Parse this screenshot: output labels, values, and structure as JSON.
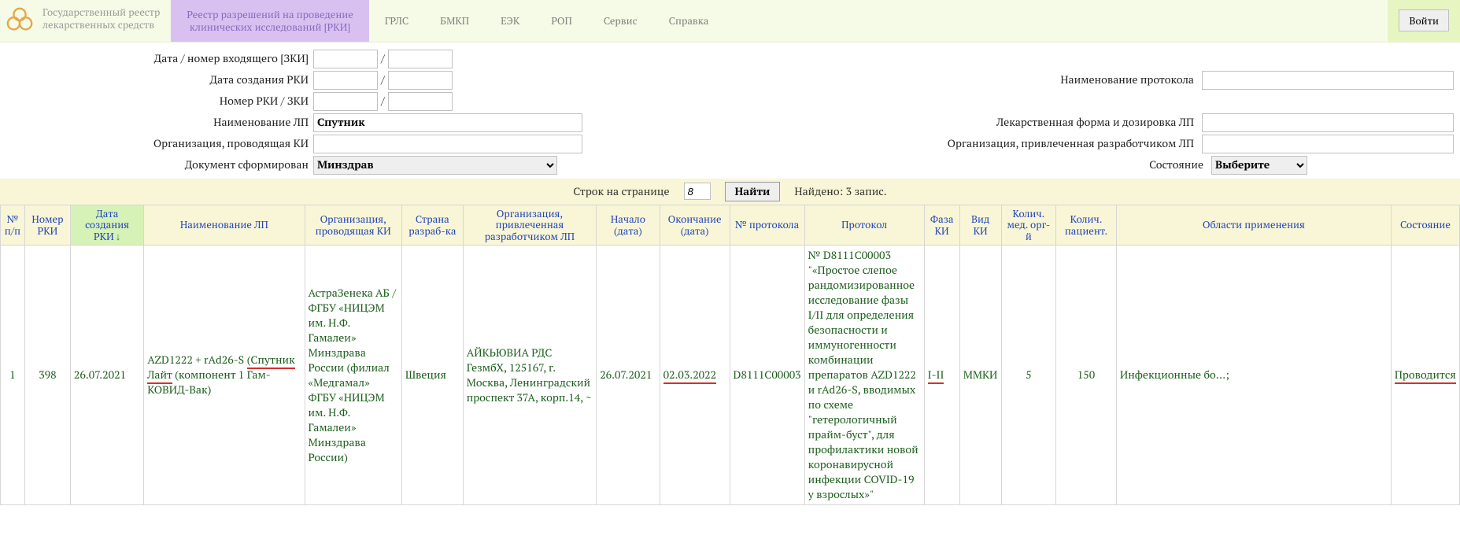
{
  "header": {
    "site_title_l1": "Государственный реестр",
    "site_title_l2": "лекарственных средств",
    "tabs": [
      {
        "label_l1": "Реестр разрешений на проведение",
        "label_l2": "клинических исследований [РКИ]",
        "active": true
      },
      {
        "label": "ГРЛС"
      },
      {
        "label": "БМКП"
      },
      {
        "label": "ЕЭК"
      },
      {
        "label": "РОП"
      },
      {
        "label": "Сервис"
      },
      {
        "label": "Справка"
      }
    ],
    "login_btn": "Войти"
  },
  "filters": {
    "f_dn_in": "Дата / номер входящего [ЗКИ]",
    "f_date_rki": "Дата создания РКИ",
    "f_num_rki": "Номер РКИ / ЗКИ",
    "f_lp_name": "Наименование ЛП",
    "v_lp_name": "Спутник",
    "f_org_conduct": "Организация, проводящая КИ",
    "f_doc_source": "Документ сформирован",
    "v_doc_source": "Минздрав",
    "f_proto_name": "Наименование протокола",
    "f_form_dose": "Лекарственная форма и дозировка ЛП",
    "f_org_dev": "Организация, привлеченная разработчиком ЛП",
    "f_state": "Состояние",
    "v_state": "Выберите"
  },
  "opts": {
    "rows_label": "Строк на странице",
    "rows_value": "8",
    "find_btn": "Найти",
    "found_text": "Найдено: 3 запис."
  },
  "columns": [
    "№ п/п",
    "Номер РКИ",
    "Дата создания РКИ",
    "Наименование ЛП",
    "Организация, проводящая КИ",
    "Страна разраб-ка",
    "Организация, привлеченная разработчиком ЛП",
    "Начало (дата)",
    "Окончание (дата)",
    "№ протокола",
    "Протокол",
    "Фаза КИ",
    "Вид КИ",
    "Колич. мед. орг-й",
    "Колич. пациент.",
    "Области применения",
    "Состояние"
  ],
  "rows": [
    {
      "idx": "1",
      "num_rki": "398",
      "date_rki": "26.07.2021",
      "lp_name": "AZD1222 + rAd26-S (Спутник Лайт (компонент 1 Гам-КОВИД-Вак)",
      "lp_name_ul": "(Спутник Лайт",
      "lp_name_before": "AZD1222 + rAd26-S ",
      "lp_name_after": " (компонент 1 Гам-КОВИД-Вак)",
      "org_conduct": "АстраЗенека АБ / ФГБУ «НИЦЭМ им. Н.Ф. Гамалеи» Минздрава России (филиал «Медгамал» ФГБУ «НИЦЭМ им. Н.Ф. Гамалеи» Минздрава России)",
      "country": "Швеция",
      "org_dev": "АЙКЬЮВИА РДС ГезмбХ, 125167, г. Москва, Ленинградский проспект 37А, корп.14, ~",
      "start": "26.07.2021",
      "end": "02.03.2022",
      "proto_num": "D8111C00003",
      "protocol": "№ D8111C00003 \"«Простое слепое рандомизированное исследование фазы I/II для определения безопасности и иммуногенности комбинации препаратов AZD1222 и rAd26-S, вводимых по схеме \"гетерологичный прайм-буст\", для профилактики новой коронавирусной инфекции COVID-19 у взрослых»\"",
      "phase": "I-II",
      "kind": "ММКИ",
      "med_orgs": "5",
      "patients": "150",
      "areas": "Инфекционные бо...;",
      "state": "Проводится"
    }
  ]
}
